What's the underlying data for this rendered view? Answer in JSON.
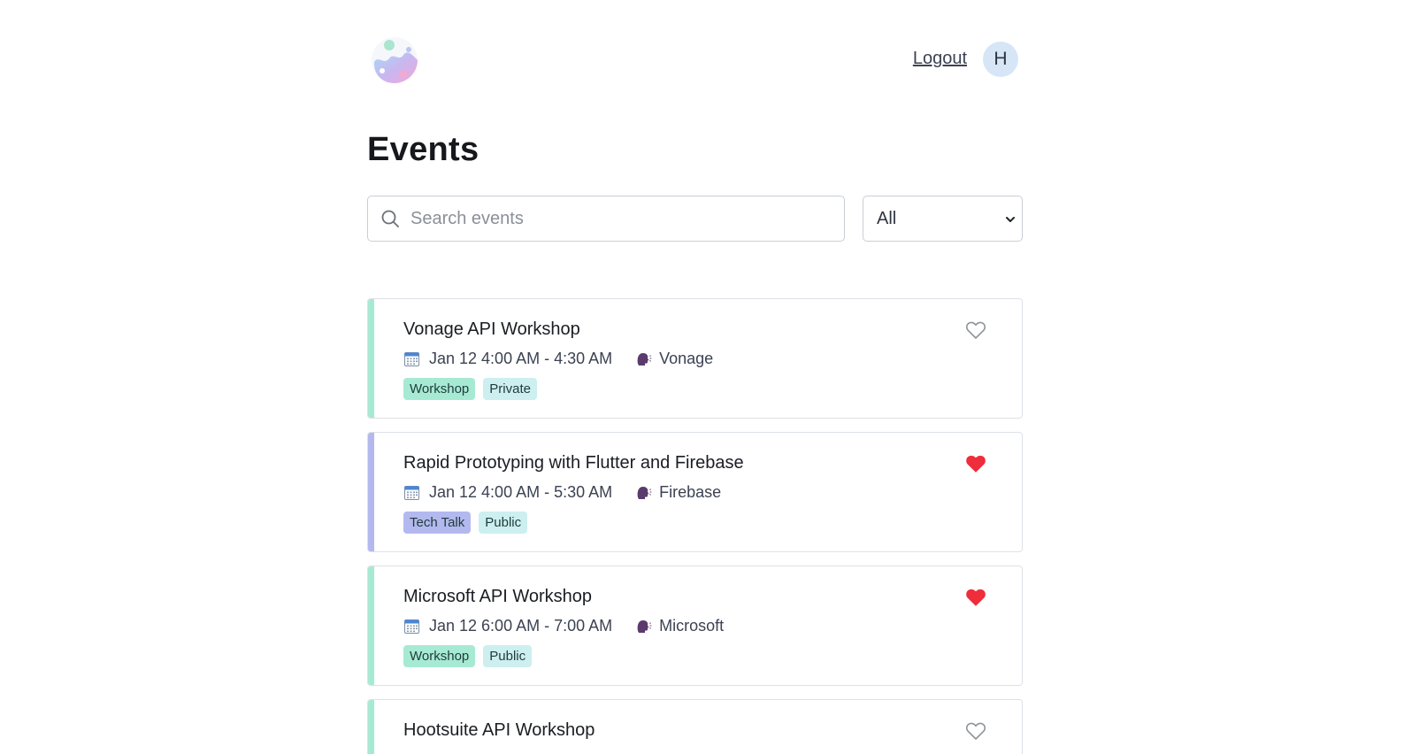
{
  "header": {
    "logout_label": "Logout",
    "avatar_initial": "H"
  },
  "page": {
    "title": "Events"
  },
  "search": {
    "placeholder": "Search events",
    "value": ""
  },
  "filter": {
    "selected": "All"
  },
  "colors": {
    "workshop_accent": "#a7ead4",
    "techtalk_accent": "#b3b9ef",
    "workshop_tag_bg": "#a7ead4",
    "techtalk_tag_bg": "#b3b9ef",
    "visibility_tag_bg": "#cdeff0",
    "heart_filled": "#ef2d3b",
    "heart_outline": "#8d939b"
  },
  "events": [
    {
      "title": "Vonage API Workshop",
      "datetime": "Jan 12 4:00 AM - 4:30 AM",
      "speaker": "Vonage",
      "type_tag": "Workshop",
      "visibility_tag": "Private",
      "favorited": false
    },
    {
      "title": "Rapid Prototyping with Flutter and Firebase",
      "datetime": "Jan 12 4:00 AM - 5:30 AM",
      "speaker": "Firebase",
      "type_tag": "Tech Talk",
      "visibility_tag": "Public",
      "favorited": true
    },
    {
      "title": "Microsoft API Workshop",
      "datetime": "Jan 12 6:00 AM - 7:00 AM",
      "speaker": "Microsoft",
      "type_tag": "Workshop",
      "visibility_tag": "Public",
      "favorited": true
    },
    {
      "title": "Hootsuite API Workshop",
      "favorited": false
    }
  ]
}
